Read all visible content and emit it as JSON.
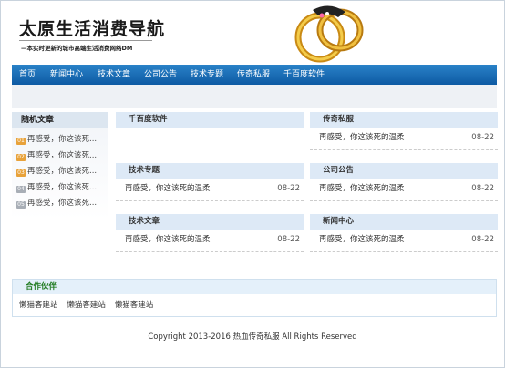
{
  "header": {
    "title": "太原生活消费导航",
    "subtitle": "—本实时更新的城市高端生活消费网络DM"
  },
  "nav": [
    "首页",
    "新闻中心",
    "技术文章",
    "公司公告",
    "技术专题",
    "传奇私服",
    "千百度软件"
  ],
  "sidebar": {
    "title": "随机文章",
    "items": [
      {
        "badge": "01",
        "text": "再感受，你这该死..."
      },
      {
        "badge": "02",
        "text": "再感受，你这该死..."
      },
      {
        "badge": "03",
        "text": "再感受，你这该死..."
      },
      {
        "badge": "04",
        "text": "再感受，你这该死..."
      },
      {
        "badge": "05",
        "text": "再感受，你这该死..."
      }
    ]
  },
  "panels": [
    {
      "title": "千百度软件",
      "rows": []
    },
    {
      "title": "传奇私服",
      "rows": [
        {
          "text": "再感受，你这该死的温柔",
          "date": "08-22"
        }
      ]
    },
    {
      "title": "技术专题",
      "rows": [
        {
          "text": "再感受，你这该死的温柔",
          "date": "08-22"
        }
      ]
    },
    {
      "title": "公司公告",
      "rows": [
        {
          "text": "再感受，你这该死的温柔",
          "date": "08-22"
        }
      ]
    },
    {
      "title": "技术文章",
      "rows": [
        {
          "text": "再感受，你这该死的温柔",
          "date": "08-22"
        }
      ]
    },
    {
      "title": "新闻中心",
      "rows": [
        {
          "text": "再感受，你这该死的温柔",
          "date": "08-22"
        }
      ]
    }
  ],
  "partners": {
    "title": "合作伙伴",
    "links": [
      "懒猫客建站",
      "懒猫客建站",
      "懒猫客建站"
    ]
  },
  "footer": "Copyright 2013-2016 热血传奇私服 All Rights Reserved"
}
